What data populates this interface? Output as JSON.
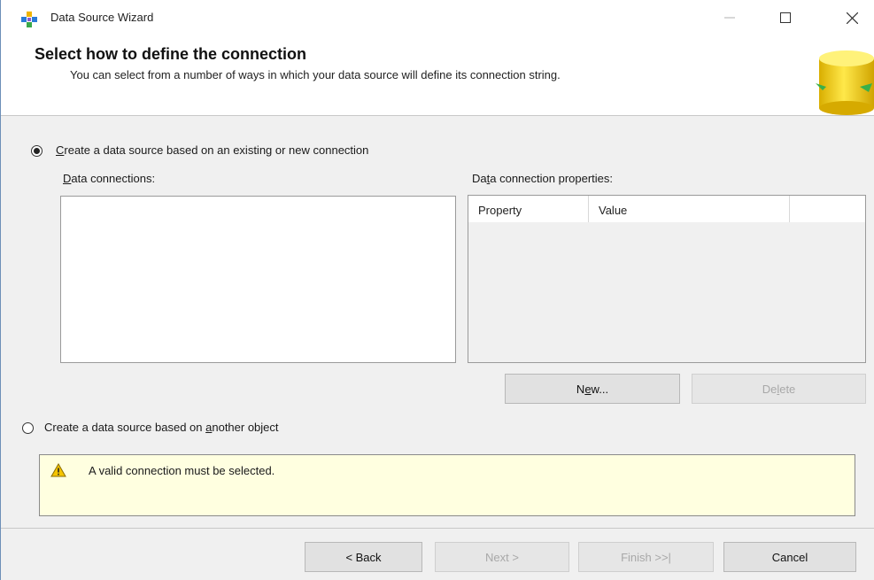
{
  "window": {
    "title": "Data Source Wizard",
    "icon": "wizard-icon"
  },
  "header": {
    "title": "Select how to define the connection",
    "description": "You can select from a number of ways in which your data source will define its connection string.",
    "art_icon": "database-cylinder-icon"
  },
  "options": {
    "existing_connection": {
      "label_access_key": "C",
      "label_rest": "reate a data source based on an existing or new connection",
      "checked": true
    },
    "another_object": {
      "label_before": "Create a data source based on ",
      "label_access_key": "a",
      "label_after": "nother object",
      "checked": false
    }
  },
  "data_connections": {
    "label_access_key": "D",
    "label_rest": "ata connections:",
    "items": []
  },
  "properties": {
    "label_before": "Da",
    "label_access_key": "t",
    "label_after": "a connection properties:",
    "columns": [
      "Property",
      "Value",
      ""
    ]
  },
  "buttons": {
    "new_before": "N",
    "new_access_key": "e",
    "new_after": "w...",
    "delete_before": "De",
    "delete_access_key": "l",
    "delete_after": "ete",
    "back": "< Back",
    "next": "Next >",
    "finish": "Finish >>|",
    "cancel": "Cancel"
  },
  "warning": {
    "icon": "warning-icon",
    "message": "A valid connection must be selected."
  },
  "colors": {
    "warning_background": "#ffffe0",
    "disabled_text": "#a8a8a8",
    "accent_yellow": "#e8c21a"
  }
}
